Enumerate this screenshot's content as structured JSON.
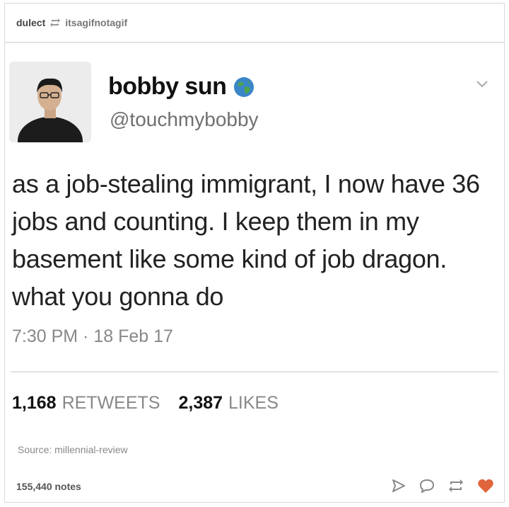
{
  "reblog": {
    "from_user": "dulect",
    "to_user": "itsagifnotagif"
  },
  "tweet": {
    "display_name": "bobby sun",
    "handle": "@touchmybobby",
    "text": "as a job-stealing immigrant, I now have 36 jobs and counting. I keep them in my basement like some kind of job dragon. what you gonna do",
    "timestamp": "7:30 PM · 18 Feb 17",
    "retweets_count": "1,168",
    "retweets_label": "RETWEETS",
    "likes_count": "2,387",
    "likes_label": "LIKES"
  },
  "post": {
    "source": "Source: millennial-review",
    "notes": "155,440 notes"
  },
  "icons": {
    "reblog": "reblog-icon",
    "globe": "globe-icon",
    "caret": "chevron-down-icon",
    "share": "share-icon",
    "reply": "reply-icon",
    "reblog_action": "reblog-icon",
    "like": "heart-icon"
  },
  "colors": {
    "like_heart": "#e0643c",
    "globe_water": "#3a86c8",
    "globe_land": "#4fa34a"
  }
}
